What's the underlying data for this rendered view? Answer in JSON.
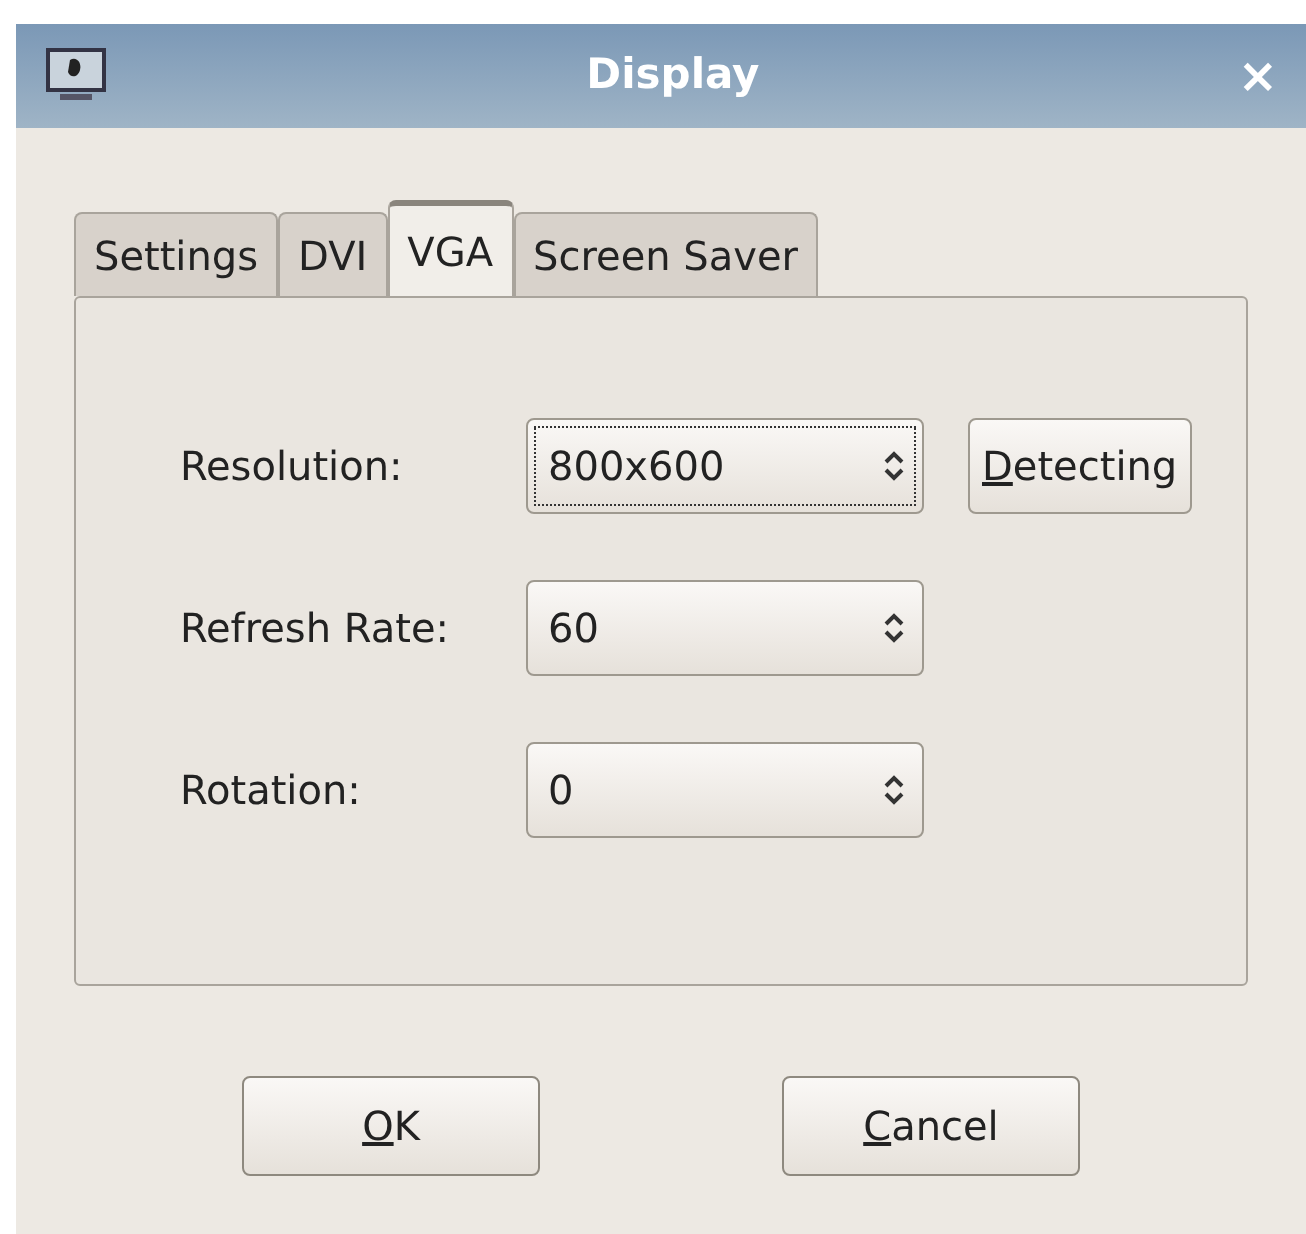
{
  "window": {
    "title": "Display",
    "close": "×"
  },
  "tabs": [
    {
      "label": "Settings",
      "selected": false
    },
    {
      "label": "DVI",
      "selected": false
    },
    {
      "label": "VGA",
      "selected": true
    },
    {
      "label": "Screen Saver",
      "selected": false
    }
  ],
  "fields": [
    {
      "label": "Resolution:",
      "value": "800x600",
      "focused": true,
      "button": {
        "label": "Detecting",
        "mnemonic_first": true
      }
    },
    {
      "label": "Refresh Rate:",
      "value": "60",
      "focused": false
    },
    {
      "label": "Rotation:",
      "value": "0",
      "focused": false
    }
  ],
  "buttons": [
    {
      "label": "OK",
      "mnemonic_first": true
    },
    {
      "label": "Cancel",
      "mnemonic_first": true
    }
  ]
}
